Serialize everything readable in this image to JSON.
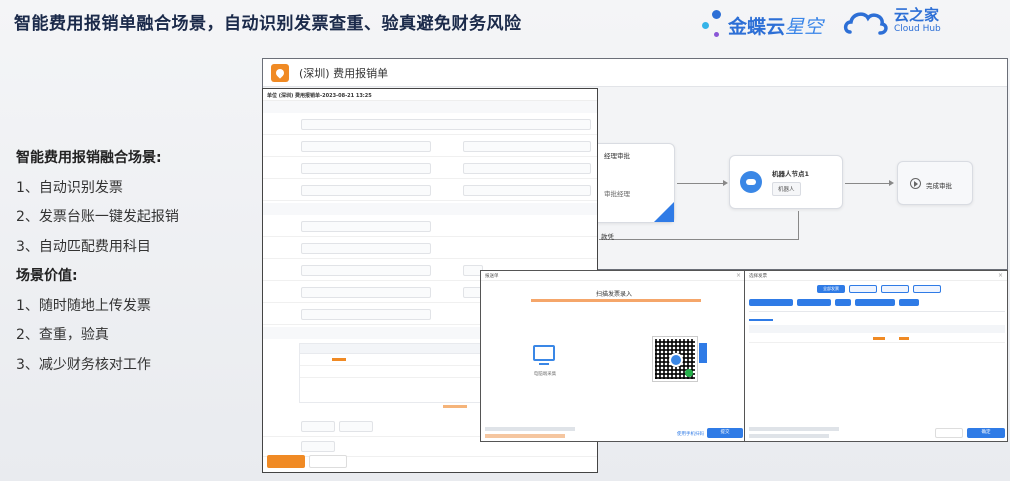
{
  "header": {
    "title": "智能费用报销单融合场景，自动识别发票查重、验真避免财务风险",
    "brand_main": "金蝶云",
    "brand_sub": "星空",
    "cloudhub_cn": "云之家",
    "cloudhub_en": "Cloud Hub"
  },
  "left_panel": {
    "lines": [
      "智能费用报销融合场景:",
      "1、自动识别发票",
      "2、发票台账一键发起报销",
      "3、自动匹配费用科目",
      "场景价值:",
      "1、随时随地上传发票",
      "2、查重，验真",
      "3、减少财务核对工作"
    ]
  },
  "workflow_window": {
    "title": "(深圳) 费用报销单",
    "node_approve": "经理审批",
    "node_approve_sub": "审批经理",
    "node_robot": "机器人节点1",
    "node_robot_tag": "机器人",
    "node_end": "完成审批",
    "branch_label": "款凭"
  },
  "form_window": {
    "header": "单位 (深圳) 费用报销单-2023-08-21 13:25"
  },
  "modal_scan": {
    "title": "报送单",
    "heading": "扫描发票录入",
    "pc_label": "电脑端采集",
    "primary_button": "提交",
    "link_text": "使用手机扫码"
  },
  "modal_list": {
    "title": "选择发票",
    "tab_active": "全部发票",
    "primary_button": "确定"
  },
  "colors": {
    "brand_blue": "#2d6fd6",
    "accent_orange": "#f08a24",
    "button_blue": "#2f7be6"
  }
}
